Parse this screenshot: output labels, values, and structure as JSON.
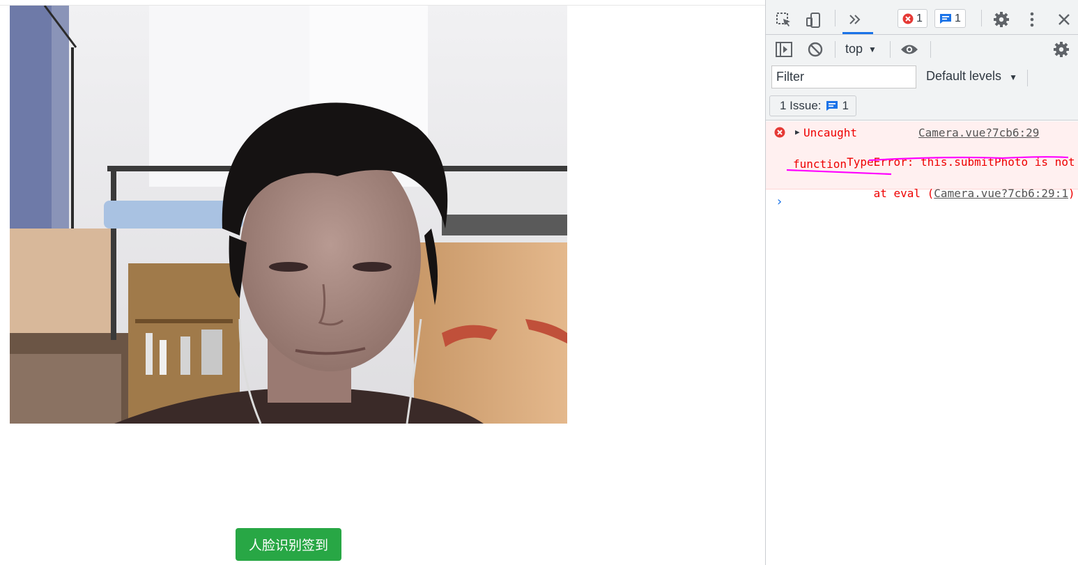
{
  "page": {
    "checkin_button": "人脸识别签到"
  },
  "devtools": {
    "error_count": "1",
    "info_count": "1",
    "context": "top",
    "filter_placeholder": "Filter",
    "levels_label": "Default levels",
    "issues_label": "1 Issue:",
    "issues_count": "1",
    "console": {
      "line1_prefix": "Uncaught",
      "source_link": "Camera.vue?7cb6:29",
      "line2_a": "TypeError: ",
      "line2_b": "this.submitPhoto is not a",
      "line3": "function",
      "line4_pre": "    at eval (",
      "line4_link": "Camera.vue?7cb6:29:1",
      "line4_post": ")"
    },
    "prompt_symbol": "›"
  },
  "colors": {
    "button_green": "#28a745",
    "error_red": "#e00",
    "annotation_magenta": "#ff00ff",
    "devtools_accent": "#1a73e8"
  }
}
